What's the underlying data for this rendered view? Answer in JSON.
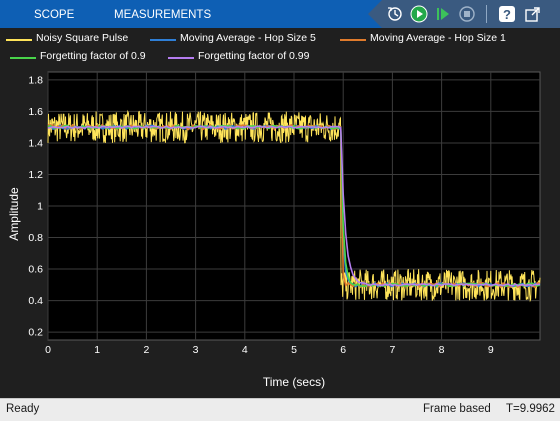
{
  "toolstrip": {
    "tabs": [
      {
        "label": "SCOPE"
      },
      {
        "label": "MEASUREMENTS"
      }
    ],
    "icons": [
      "step-back-icon",
      "run-icon",
      "step-forward-icon",
      "stop-icon",
      "help-icon",
      "undock-icon"
    ],
    "accent_color": "#0e5fb4"
  },
  "legend": {
    "entries": [
      {
        "label": "Noisy Square Pulse",
        "color": "#ffe45a"
      },
      {
        "label": "Moving Average - Hop Size 5",
        "color": "#2f7fd6"
      },
      {
        "label": "Moving Average - Hop Size 1",
        "color": "#e07b2c"
      },
      {
        "label": "Forgetting factor of 0.9",
        "color": "#49d44a"
      },
      {
        "label": "Forgetting factor of 0.99",
        "color": "#b57df0"
      }
    ]
  },
  "chart_data": {
    "type": "line",
    "xlabel": "Time (secs)",
    "ylabel": "Amplitude",
    "xlim": [
      0,
      10
    ],
    "ylim": [
      0.15,
      1.85
    ],
    "xticks": [
      "0",
      "1",
      "2",
      "3",
      "4",
      "5",
      "6",
      "7",
      "8",
      "9"
    ],
    "yticks": [
      "0.2",
      "0.4",
      "0.6",
      "0.8",
      "1",
      "1.2",
      "1.4",
      "1.6",
      "1.8"
    ],
    "grid": true,
    "legend_position": "top",
    "step_time": 5.95,
    "series": [
      {
        "name": "Noisy Square Pulse",
        "high_level": 1.5,
        "low_level": 0.5,
        "noise_amplitude": 0.1
      },
      {
        "name": "Moving Average - Hop Size 5",
        "high_level": 1.5,
        "low_level": 0.5
      },
      {
        "name": "Moving Average - Hop Size 1",
        "high_level": 1.5,
        "low_level": 0.5
      },
      {
        "name": "Forgetting factor of 0.9",
        "high_level": 1.5,
        "low_level": 0.5
      },
      {
        "name": "Forgetting factor of 0.99",
        "high_level": 1.5,
        "low_level": 0.5
      }
    ]
  },
  "status": {
    "ready": "Ready",
    "mode": "Frame based",
    "time": "T=9.9962"
  }
}
